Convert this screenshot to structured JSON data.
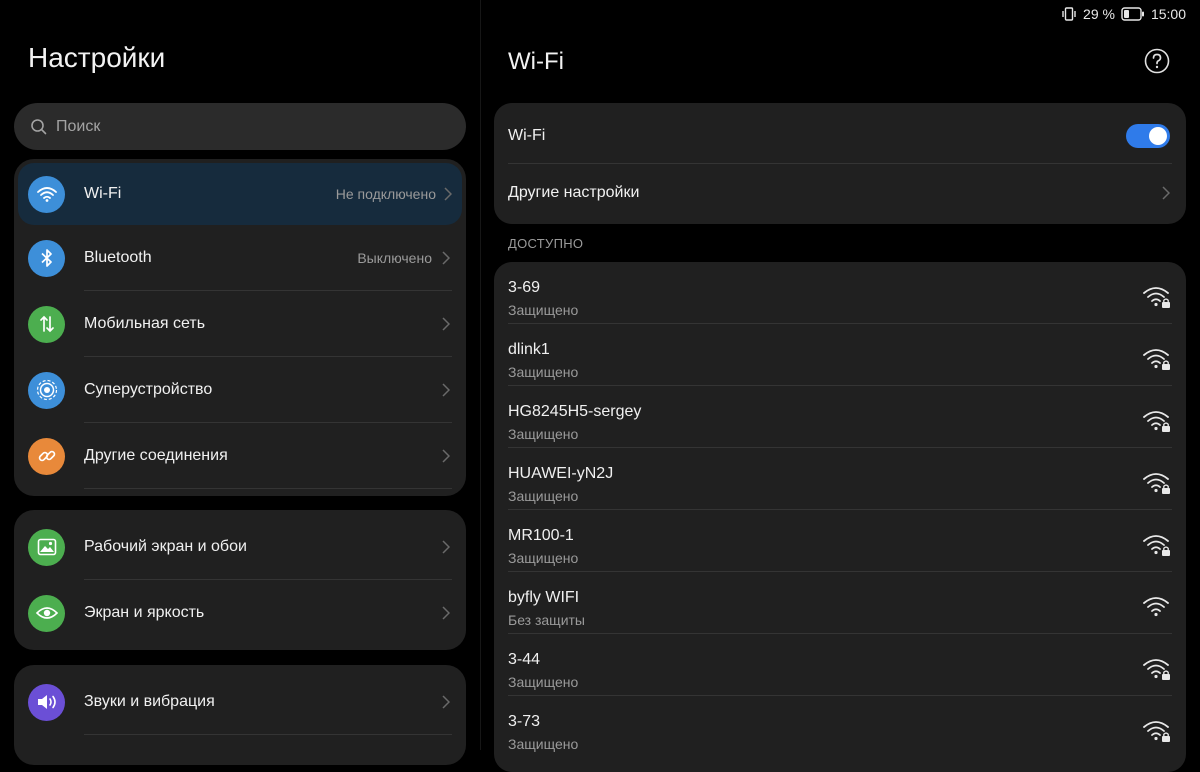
{
  "status_bar": {
    "battery_percent": "29 %",
    "time": "15:00"
  },
  "left": {
    "title": "Настройки",
    "search_placeholder": "Поиск",
    "group1": [
      {
        "label": "Wi-Fi",
        "value": "Не подключено",
        "icon": "wifi-icon",
        "color": "#3d8fd9"
      },
      {
        "label": "Bluetooth",
        "value": "Выключено",
        "icon": "bluetooth-icon",
        "color": "#3d8fd9"
      },
      {
        "label": "Мобильная сеть",
        "value": "",
        "icon": "mobile-network-icon",
        "color": "#4cae4f"
      },
      {
        "label": "Суперустройство",
        "value": "",
        "icon": "superdevice-icon",
        "color": "#3d8fd9"
      },
      {
        "label": "Другие соединения",
        "value": "",
        "icon": "link-icon",
        "color": "#e8893a"
      }
    ],
    "group2": [
      {
        "label": "Рабочий экран и обои",
        "icon": "wallpaper-icon",
        "color": "#4cae4f"
      },
      {
        "label": "Экран и яркость",
        "icon": "eye-icon",
        "color": "#4cae4f"
      }
    ],
    "group3": [
      {
        "label": "Звуки и вибрация",
        "icon": "speaker-icon",
        "color": "#6b4fd6"
      }
    ]
  },
  "right": {
    "title": "Wi-Fi",
    "wifi_toggle_label": "Wi-Fi",
    "wifi_on": true,
    "other_settings_label": "Другие настройки",
    "available_header": "ДОСТУПНО",
    "networks": [
      {
        "name": "3-69",
        "status": "Защищено",
        "secured": true
      },
      {
        "name": "dlink1",
        "status": "Защищено",
        "secured": true
      },
      {
        "name": "HG8245H5-sergey",
        "status": "Защищено",
        "secured": true
      },
      {
        "name": "HUAWEI-yN2J",
        "status": "Защищено",
        "secured": true
      },
      {
        "name": "MR100-1",
        "status": "Защищено",
        "secured": true
      },
      {
        "name": "byfly WIFI",
        "status": "Без защиты",
        "secured": false
      },
      {
        "name": "3-44",
        "status": "Защищено",
        "secured": true
      },
      {
        "name": "3-73",
        "status": "Защищено",
        "secured": true
      }
    ]
  },
  "colors": {
    "accent": "#2f7bea",
    "active_row": "#162b3d",
    "card": "#202020"
  }
}
